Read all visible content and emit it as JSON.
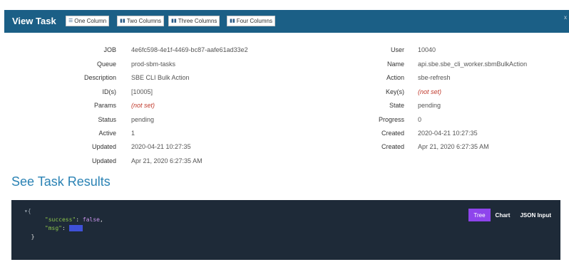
{
  "header": {
    "title": "View Task",
    "buttons": [
      "One Column",
      "Two Columns",
      "Three Columns",
      "Four Columns"
    ],
    "close": "x"
  },
  "task": {
    "left": [
      {
        "label": "JOB",
        "value": "4e6fc598-4e1f-4469-bc87-aafe61ad33e2"
      },
      {
        "label": "Queue",
        "value": "prod-sbm-tasks"
      },
      {
        "label": "Description",
        "value": "SBE CLI Bulk Action"
      },
      {
        "label": "ID(s)",
        "value": "[10005]"
      },
      {
        "label": "Params",
        "value": "(not set)"
      },
      {
        "label": "Status",
        "value": "pending"
      },
      {
        "label": "Active",
        "value": "1"
      },
      {
        "label": "Updated",
        "value": "2020-04-21 10:27:35"
      },
      {
        "label": "Updated",
        "value": "Apr 21, 2020 6:27:35 AM"
      }
    ],
    "right": [
      {
        "label": "User",
        "value": "10040"
      },
      {
        "label": "Name",
        "value": "api.sbe.sbe_cli_worker.sbmBulkAction"
      },
      {
        "label": "Action",
        "value": "sbe-refresh"
      },
      {
        "label": "Key(s)",
        "value": "(not set)"
      },
      {
        "label": "State",
        "value": "pending"
      },
      {
        "label": "Progress",
        "value": "0"
      },
      {
        "label": "Created",
        "value": "2020-04-21 10:27:35"
      },
      {
        "label": "Created",
        "value": "Apr 21, 2020 6:27:35 AM"
      }
    ]
  },
  "results": {
    "title": "See Task Results",
    "json": {
      "open_toggle": "▾{",
      "success_key": "\"success\"",
      "success_value": "false",
      "msg_key": "\"msg\"",
      "msg_value": "null",
      "close_brace": "}"
    },
    "tabs": [
      "Tree",
      "Chart",
      "JSON Input"
    ],
    "active_tab": "Tree"
  },
  "colors": {
    "header_bg": "#1b5f86",
    "title_link": "#2a82b4",
    "not_set": "#c0392b",
    "panel_bg": "#1e2a38",
    "active_tab": "#8e44ec"
  }
}
